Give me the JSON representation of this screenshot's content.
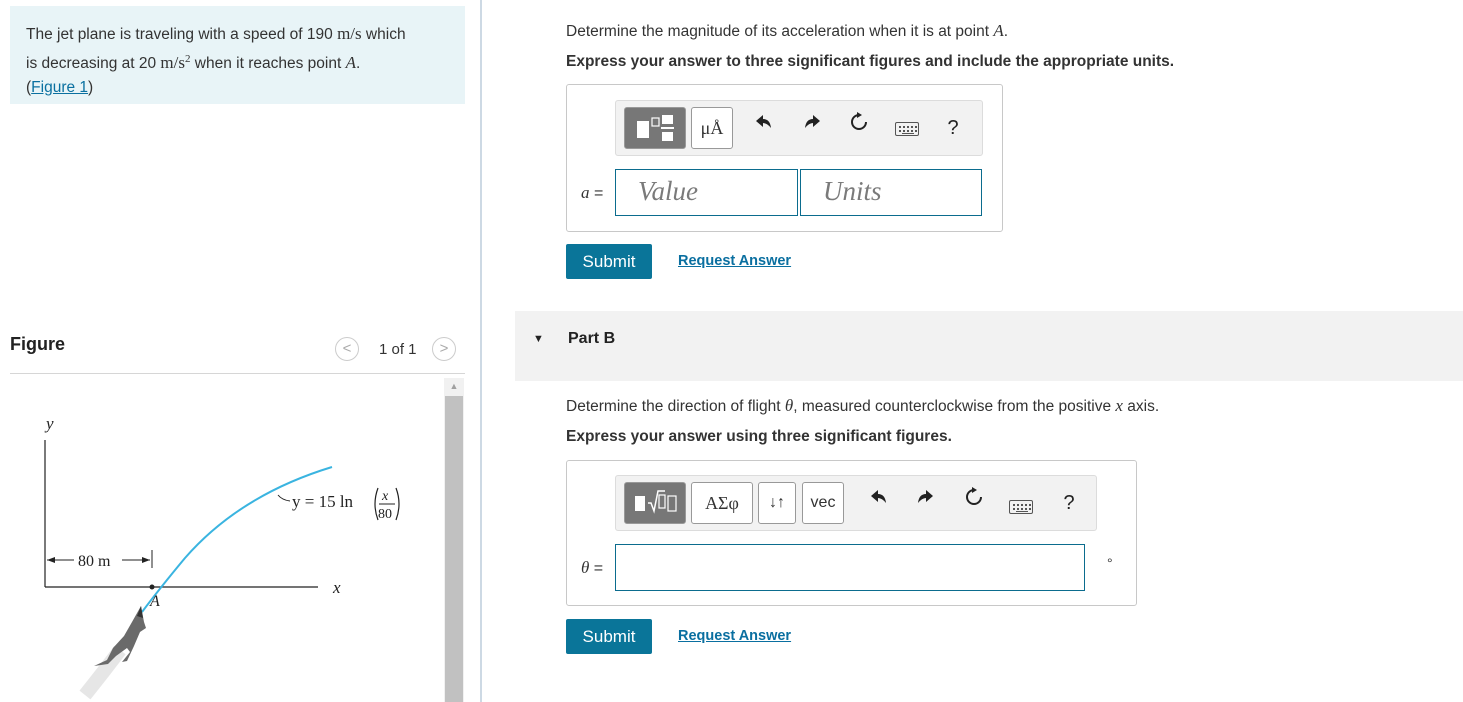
{
  "problem": {
    "line1_pre": "The jet plane is traveling with a speed of 190 ",
    "speed_unit": "m/s",
    "line1_post": " which",
    "line2_pre": "is decreasing at 20 ",
    "accel_unit": "m/s",
    "accel_exp": "2",
    "line2_mid": " when it reaches point ",
    "point": "A",
    "line2_end": ".",
    "figure_link_open": "(",
    "figure_link": "Figure 1",
    "figure_link_close": ")"
  },
  "figure": {
    "title": "Figure",
    "count": "1 of 1",
    "prev": "<",
    "next": ">",
    "labels": {
      "y_axis": "y",
      "x_axis": "x",
      "equation_lhs": "y = 15 ln",
      "frac_num": "x",
      "frac_den": "80",
      "dimension": "80 m",
      "point": "A"
    }
  },
  "part_a": {
    "question_pre": "Determine the magnitude of its acceleration when it is at point ",
    "question_point": "A",
    "question_end": ".",
    "instruction": "Express your answer to three significant figures and include the appropriate units.",
    "toolbar": {
      "units_btn": "μÅ",
      "help": "?"
    },
    "var_label": "a",
    "equals": " =",
    "value_placeholder": "Value",
    "units_placeholder": "Units",
    "submit": "Submit",
    "request": "Request Answer"
  },
  "part_b": {
    "caret": "▼",
    "title": "Part B",
    "question_pre": "Determine the direction of flight ",
    "question_theta": "θ",
    "question_mid": ", measured counterclockwise from the positive ",
    "question_x": "x",
    "question_end": " axis.",
    "instruction": "Express your answer using three significant figures.",
    "toolbar": {
      "greek_btn": "ΑΣφ",
      "arrows_btn": "↓↑",
      "vec_btn": "vec",
      "help": "?"
    },
    "var_label": "θ",
    "equals": " =",
    "degree": "°",
    "submit": "Submit",
    "request": "Request Answer"
  },
  "colors": {
    "accent": "#0a7599",
    "link": "#0a6fa0",
    "curve": "#3ab4e0",
    "problem_bg": "#e8f4f7"
  }
}
